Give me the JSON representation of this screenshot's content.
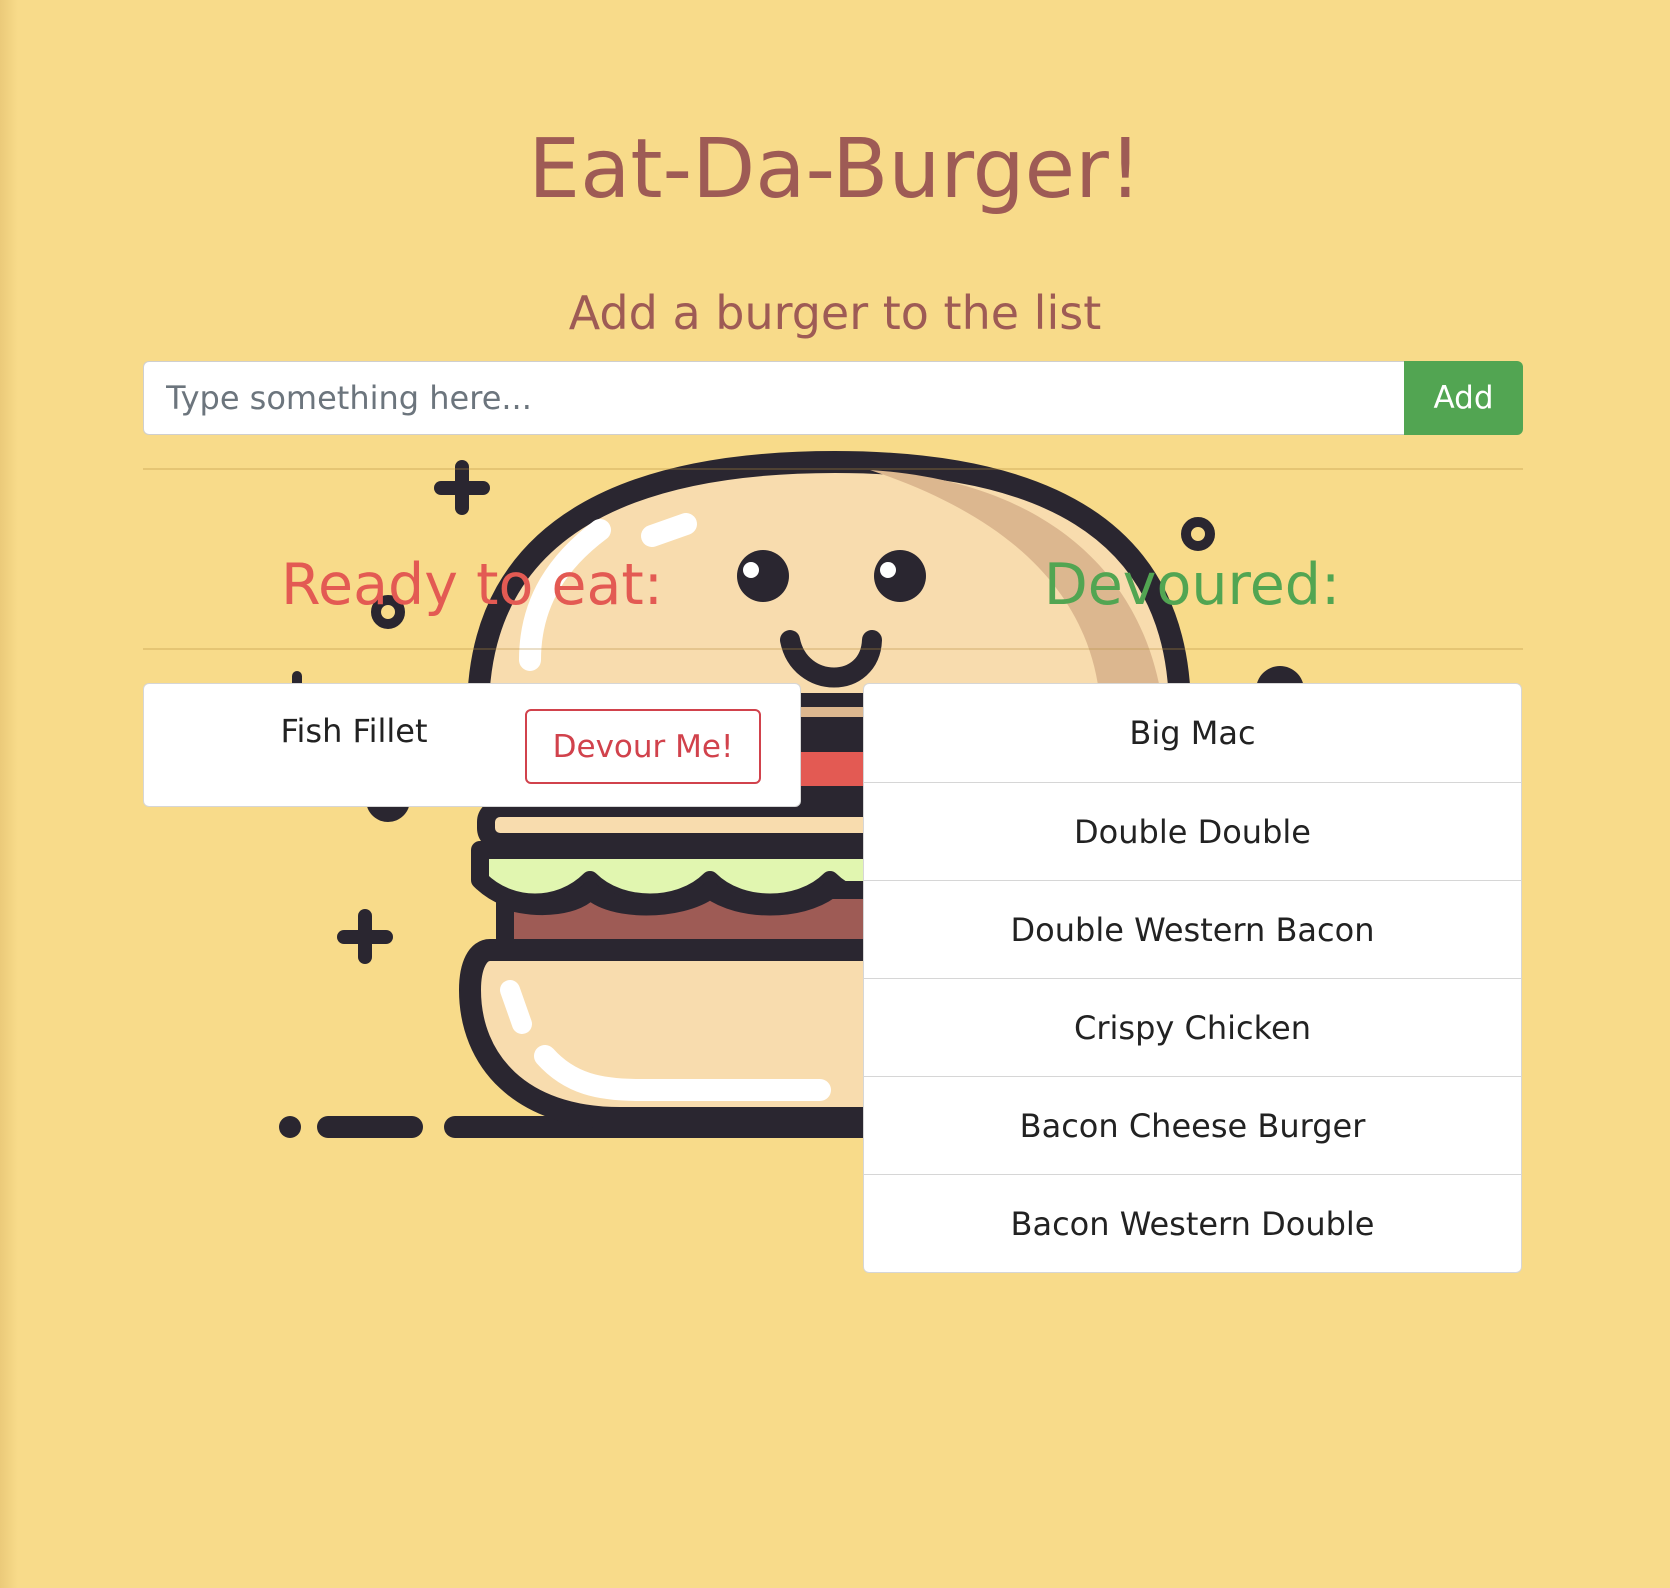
{
  "header": {
    "title": "Eat-Da-Burger!",
    "subtitle": "Add a burger to the list"
  },
  "form": {
    "placeholder": "Type something here...",
    "value": "",
    "add_label": "Add"
  },
  "ready": {
    "heading": "Ready to eat:",
    "items": [
      {
        "name": "Fish Fillet",
        "action_label": "Devour Me!"
      }
    ]
  },
  "devoured": {
    "heading": "Devoured:",
    "items": [
      "Big Mac",
      "Double Double",
      "Double Western Bacon",
      "Crispy Chicken",
      "Bacon Cheese Burger",
      "Bacon Western Double"
    ]
  },
  "colors": {
    "background": "#f8db8a",
    "title": "#9e5b55",
    "ready_heading": "#e35a53",
    "devoured_heading": "#52a552",
    "add_button": "#52a552",
    "devour_button": "#d1424c"
  },
  "icons": [
    "burger-illustration",
    "plus-icon",
    "ring-icon"
  ]
}
